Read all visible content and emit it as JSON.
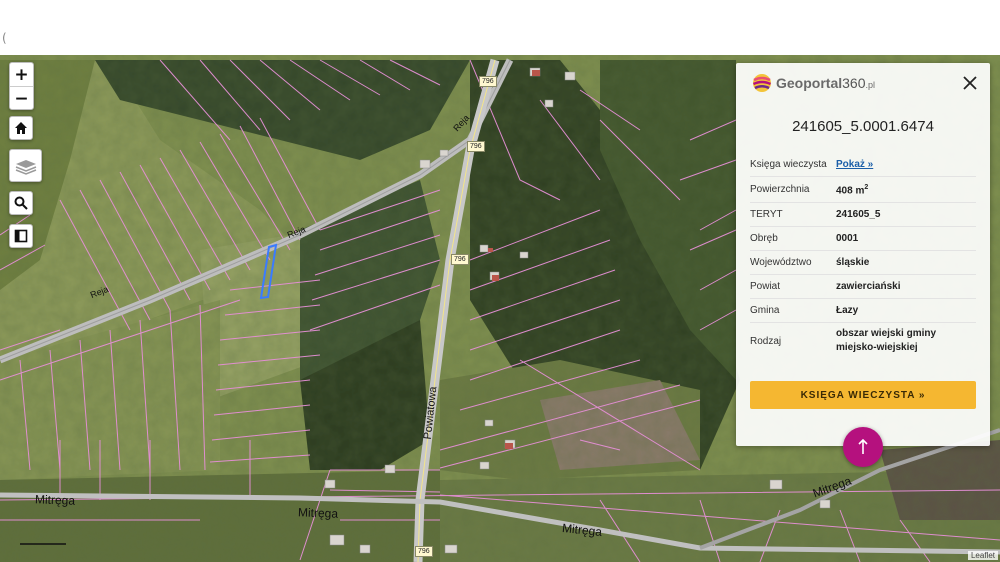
{
  "top": {
    "cursor_mark": "("
  },
  "map": {
    "controls": {
      "zoom_in": "+",
      "zoom_out": "−"
    },
    "road_labels": [
      "Reja",
      "Reja",
      "Powiatowa",
      "Mitręga",
      "Mitręga",
      "Mitręga",
      "Mitręga"
    ],
    "road_number": "796",
    "attribution": "Leaflet",
    "colors": {
      "parcel_lines": "#e58fd6",
      "selected_parcel": "#3a7bff",
      "road": "#c9c9c9"
    }
  },
  "panel": {
    "logo": {
      "name": "Geoportal",
      "num": "360",
      "suffix": ".pl"
    },
    "parcel_id": "241605_5.0001.6474",
    "rows": [
      {
        "label": "Księga wieczysta",
        "value": "Pokaż »",
        "link": true
      },
      {
        "label": "Powierzchnia",
        "value": "408 m",
        "sup": "2"
      },
      {
        "label": "TERYT",
        "value": "241605_5"
      },
      {
        "label": "Obręb",
        "value": "0001"
      },
      {
        "label": "Województwo",
        "value": "śląskie"
      },
      {
        "label": "Powiat",
        "value": "zawierciański"
      },
      {
        "label": "Gmina",
        "value": "Łazy"
      },
      {
        "label": "Rodzaj",
        "value": "obszar wiejski gminy miejsko-wiejskiej"
      }
    ],
    "button": "KSIĘGA WIECZYSTA »",
    "colors": {
      "button": "#f5b731",
      "fab": "#b5117e"
    }
  }
}
